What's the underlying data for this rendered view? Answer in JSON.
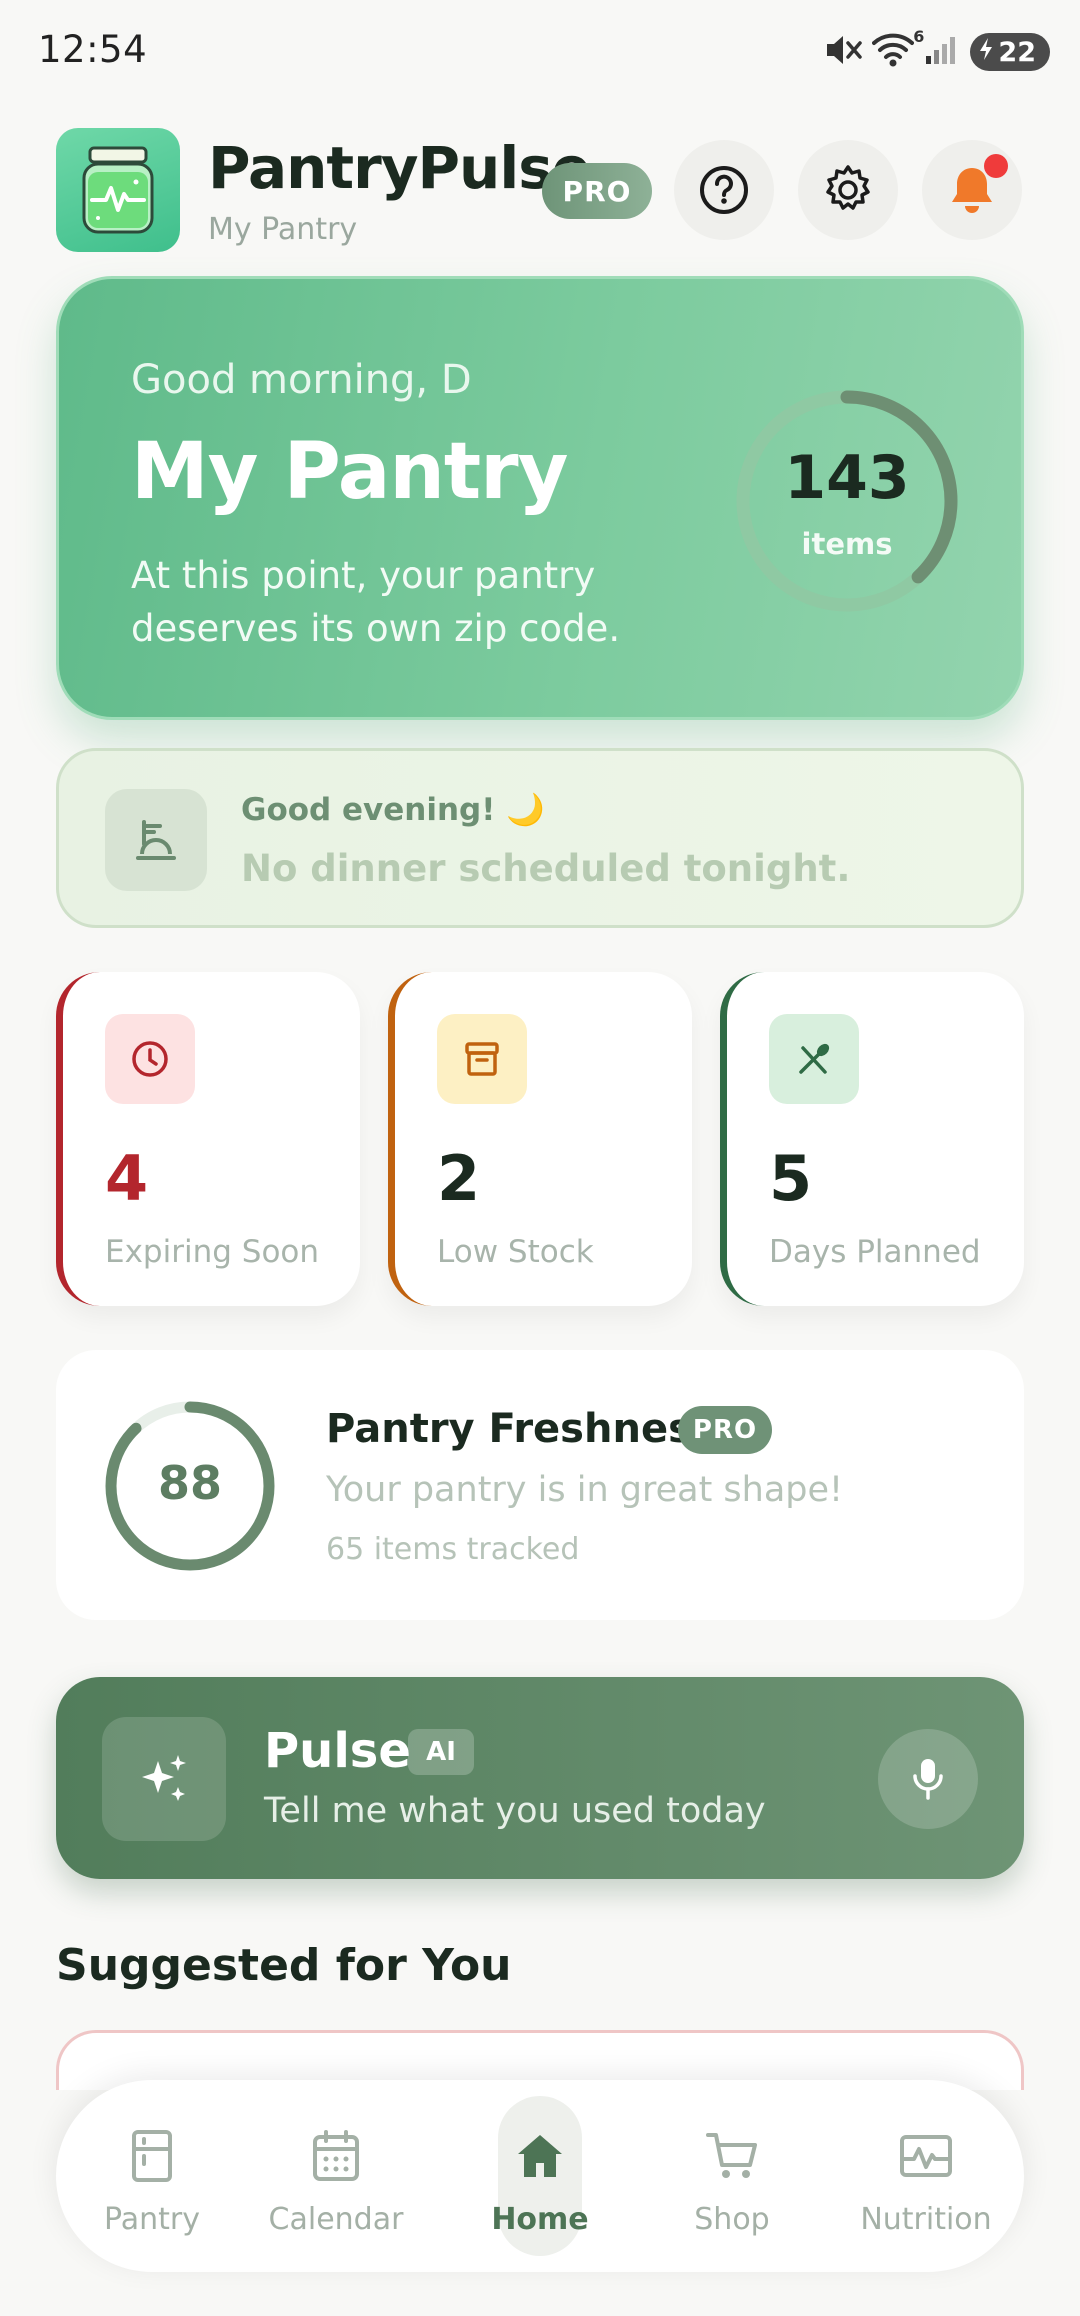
{
  "status_bar": {
    "time": "12:54",
    "battery": "22",
    "wifi_label": "6"
  },
  "header": {
    "app_name": "PantryPulse",
    "subtitle": "My Pantry",
    "pro_badge": "PRO"
  },
  "hero": {
    "greeting": "Good morning, D",
    "title": "My Pantry",
    "tagline": "At this point, your pantry deserves its own zip code.",
    "item_count": "143",
    "item_label": "items",
    "ring_progress": 0.38
  },
  "dinner": {
    "greeting": "Good evening! 🌙",
    "message": "No dinner scheduled tonight."
  },
  "stats": [
    {
      "value": "4",
      "label": "Expiring Soon",
      "accent": "#b3262d",
      "icon_bg": "#fde2e2",
      "icon": "clock-icon"
    },
    {
      "value": "2",
      "label": "Low Stock",
      "accent": "#c0620f",
      "icon_bg": "#fdf0c4",
      "icon": "archive-icon"
    },
    {
      "value": "5",
      "label": "Days Planned",
      "accent": "#2f6b45",
      "icon_bg": "#d8efdd",
      "icon": "utensils-icon"
    }
  ],
  "freshness": {
    "score": "88",
    "title": "Pantry Freshness",
    "pro_badge": "PRO",
    "description": "Your pantry is in great shape!",
    "tracked": "65 items tracked",
    "progress": 0.88
  },
  "pulse": {
    "title": "Pulse",
    "badge": "AI",
    "subtitle": "Tell me what you used today"
  },
  "suggested": {
    "title": "Suggested for You"
  },
  "nav": [
    {
      "label": "Pantry",
      "icon": "pantry-icon",
      "active": false
    },
    {
      "label": "Calendar",
      "icon": "calendar-icon",
      "active": false
    },
    {
      "label": "Home",
      "icon": "home-icon",
      "active": true
    },
    {
      "label": "Shop",
      "icon": "cart-icon",
      "active": false
    },
    {
      "label": "Nutrition",
      "icon": "pulse-chart-icon",
      "active": false
    }
  ],
  "colors": {
    "primary": "#5fba8a",
    "pulse_bg": "#5a855f",
    "nav_active": "#4d7455"
  }
}
